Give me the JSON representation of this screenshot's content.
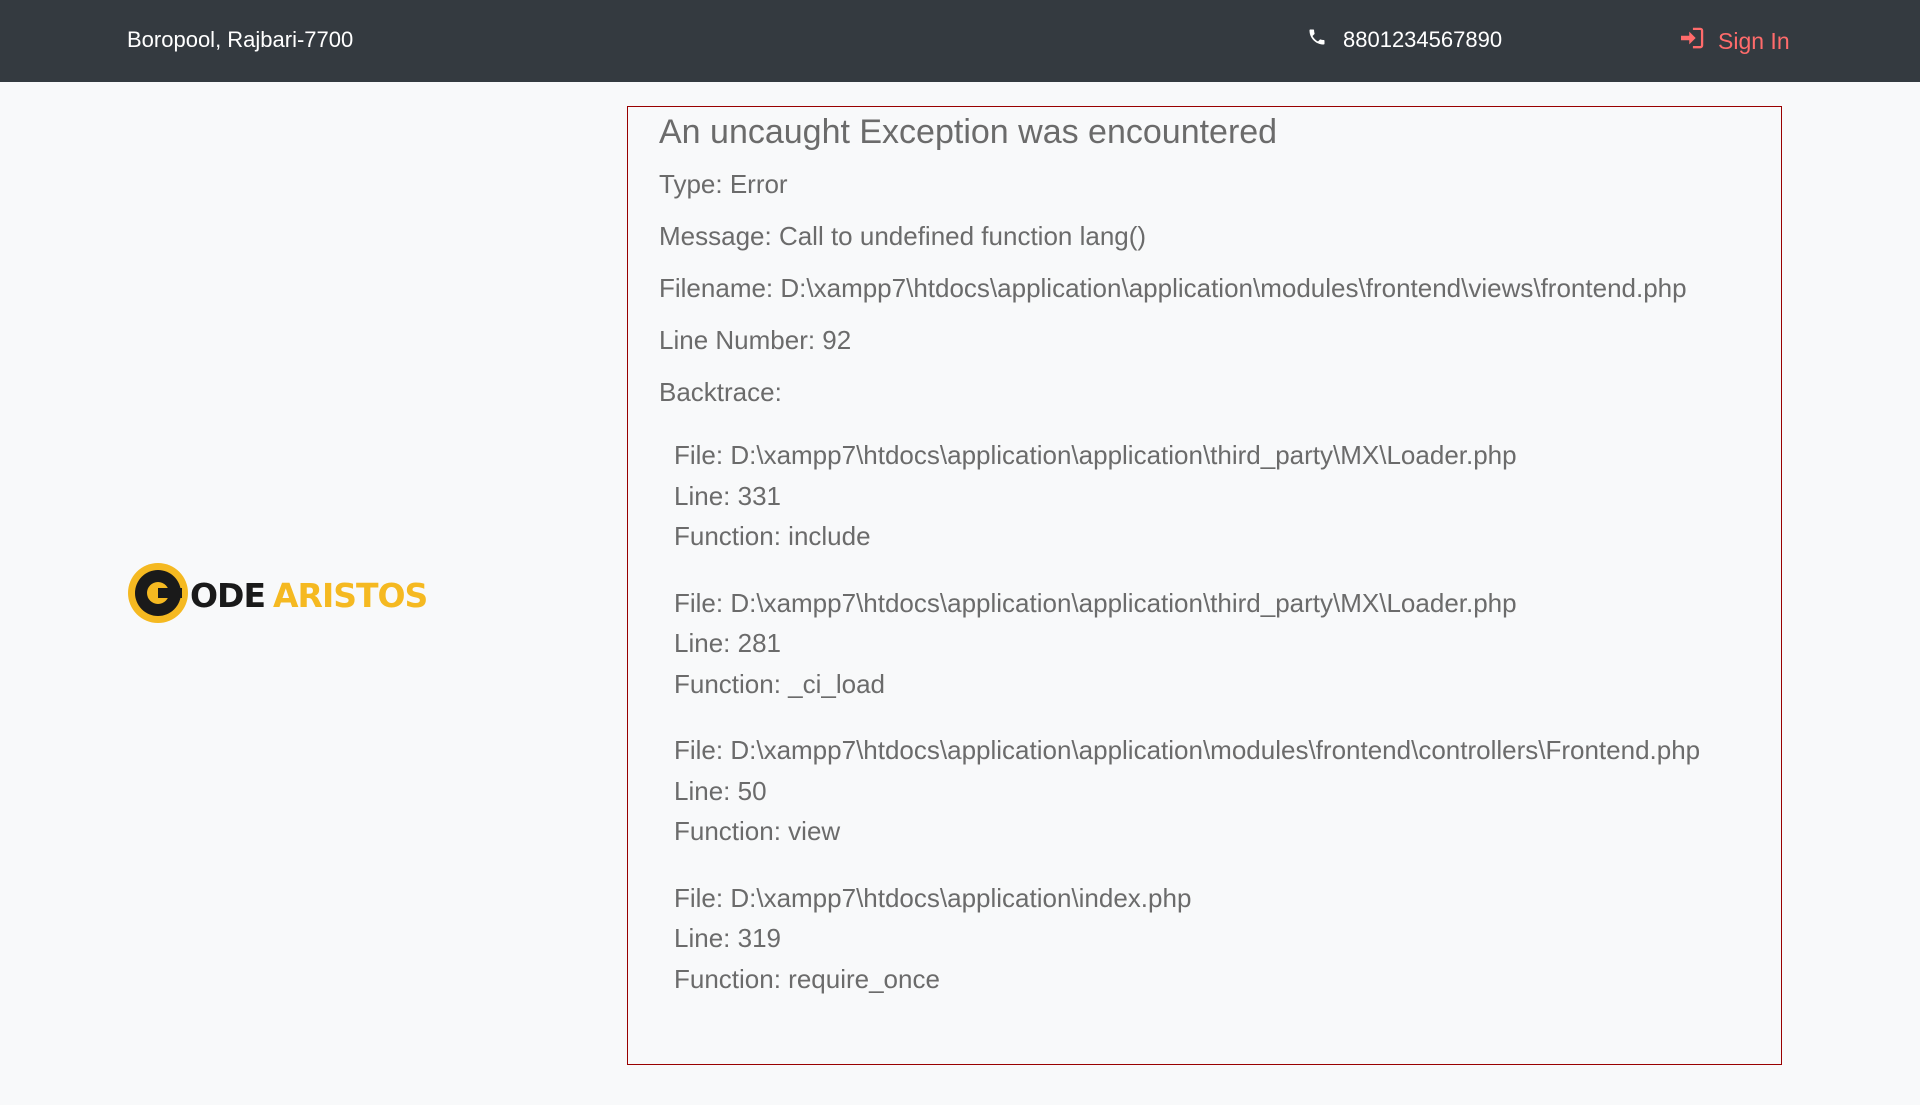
{
  "header": {
    "address": "Boropool, Rajbari-7700",
    "phone": "8801234567890",
    "signin_label": "Sign In",
    "signin_color": "#ff6b6b",
    "background": "#343a40"
  },
  "logo": {
    "part1": "ODE",
    "part2": "ARISTOS",
    "accent_color": "#f5b921"
  },
  "error": {
    "title": "An uncaught Exception was encountered",
    "type": "Type: Error",
    "message": "Message: Call to undefined function lang()",
    "filename": "Filename: D:\\xampp7\\htdocs\\application\\application\\modules\\frontend\\views\\frontend.php",
    "line_number": "Line Number: 92",
    "backtrace_label": "Backtrace:",
    "backtrace": [
      {
        "file": "File: D:\\xampp7\\htdocs\\application\\application\\third_party\\MX\\Loader.php",
        "line": "Line: 331",
        "function": "Function: include"
      },
      {
        "file": "File: D:\\xampp7\\htdocs\\application\\application\\third_party\\MX\\Loader.php",
        "line": "Line: 281",
        "function": "Function: _ci_load"
      },
      {
        "file": "File: D:\\xampp7\\htdocs\\application\\application\\modules\\frontend\\controllers\\Frontend.php",
        "line": "Line: 50",
        "function": "Function: view"
      },
      {
        "file": "File: D:\\xampp7\\htdocs\\application\\index.php",
        "line": "Line: 319",
        "function": "Function: require_once"
      }
    ],
    "border_color": "#990000"
  }
}
